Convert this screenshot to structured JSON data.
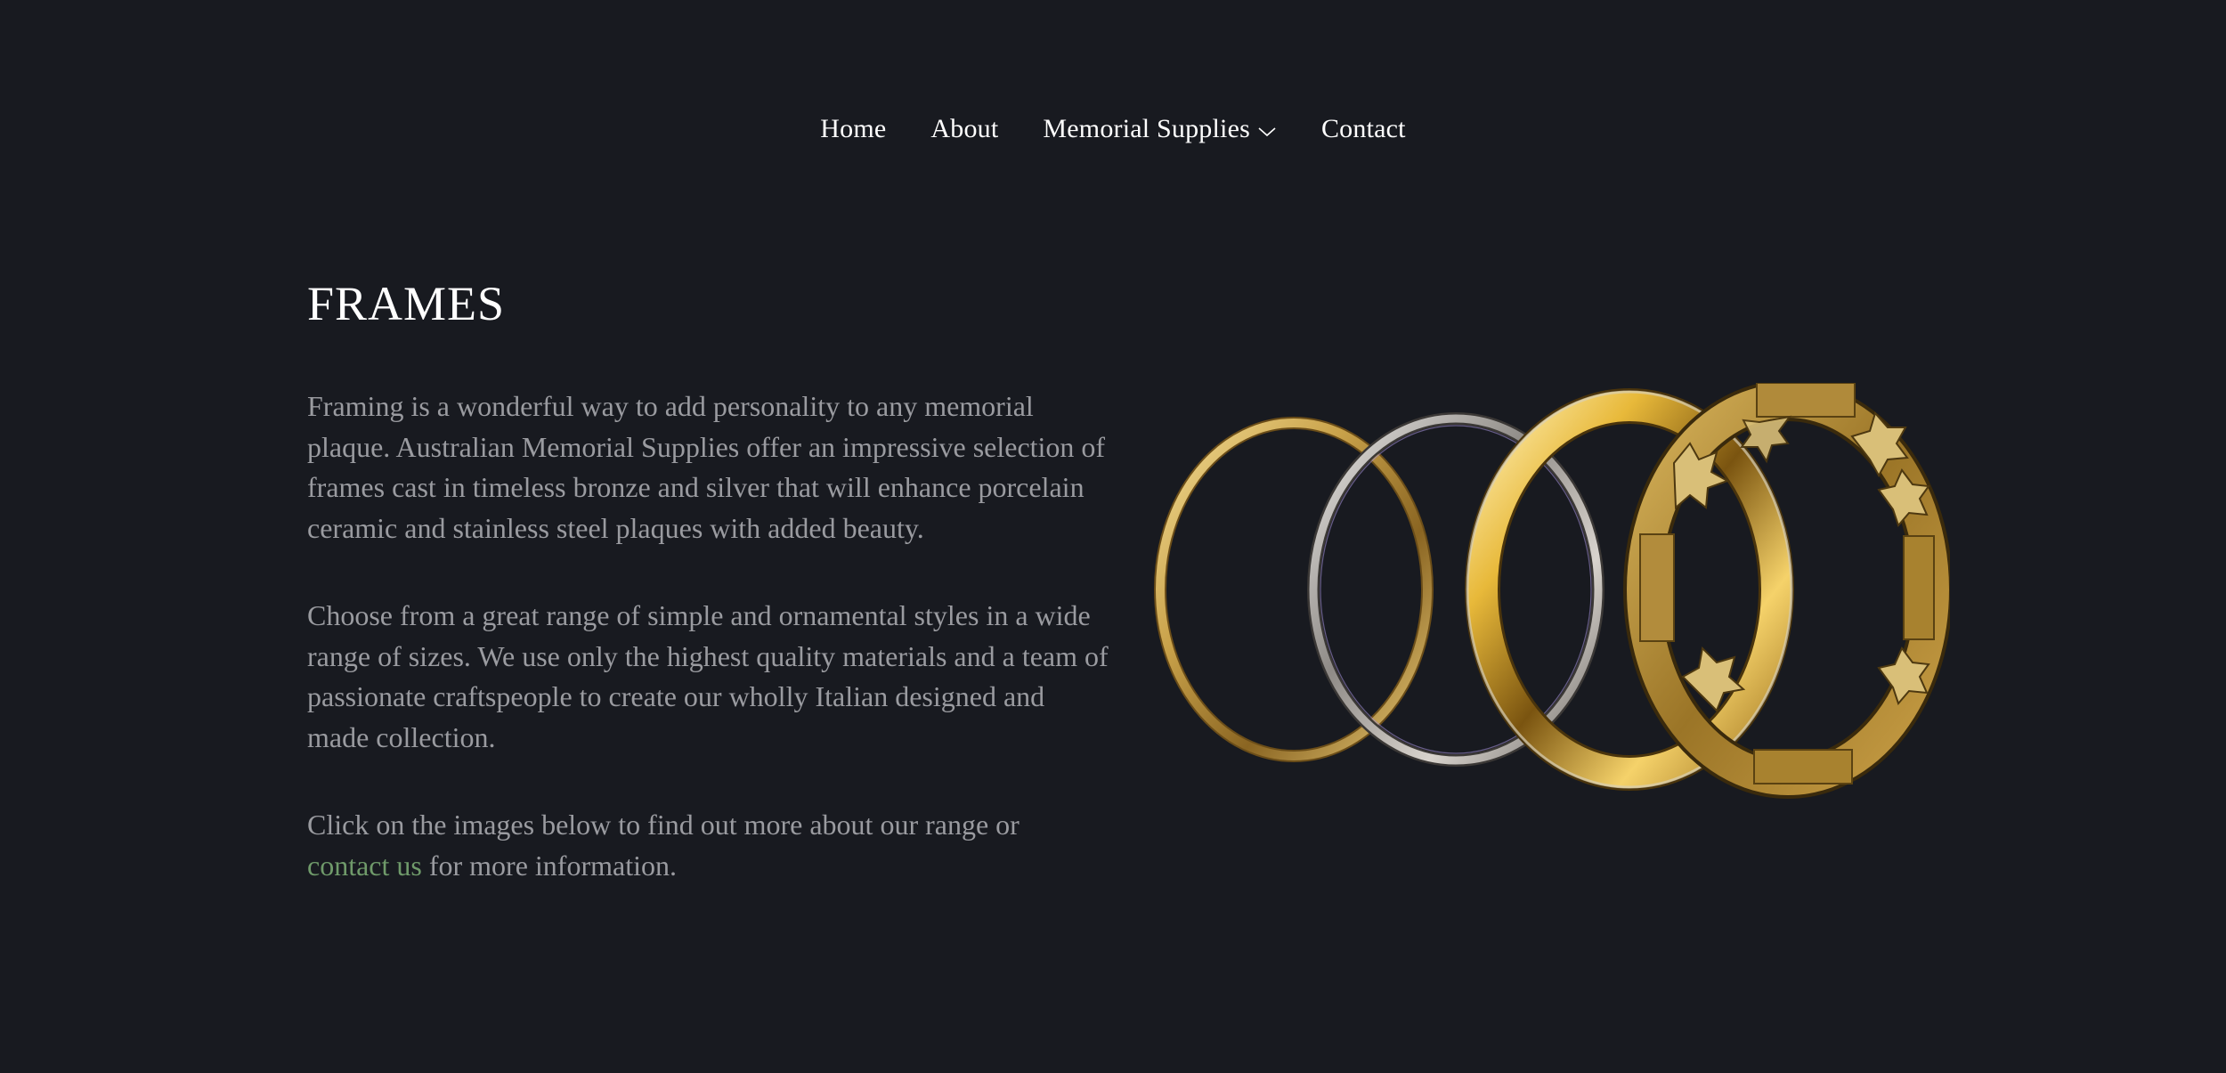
{
  "nav": {
    "items": [
      {
        "label": "Home"
      },
      {
        "label": "About"
      },
      {
        "label": "Memorial Supplies",
        "dropdown_icon": "chevron-down-icon"
      },
      {
        "label": "Contact"
      }
    ]
  },
  "main": {
    "title": "FRAMES",
    "paragraphs": [
      "Framing is a wonderful way to add personality to any memorial plaque. Australian Memorial Supplies offer an impressive selection of frames cast in timeless bronze and silver that will enhance porcelain ceramic and stainless steel plaques with added beauty.",
      "Choose from a great range of simple and ornamental styles in a wide range of sizes. We use only the highest quality materials and a team of passionate craftspeople to create our wholly Italian designed and made collection."
    ],
    "cta": {
      "before": "Click on the images below to find out more about our range or ",
      "link": "contact us",
      "after": " for more information."
    }
  },
  "image": {
    "subject": "frames-rings-image"
  },
  "colors": {
    "background": "#181a20",
    "text": "#ffffff",
    "muted_text": "#9a9ba0",
    "link": "#6f9a6a",
    "gold": "#c9a24a",
    "silver": "#b8b4b0"
  }
}
